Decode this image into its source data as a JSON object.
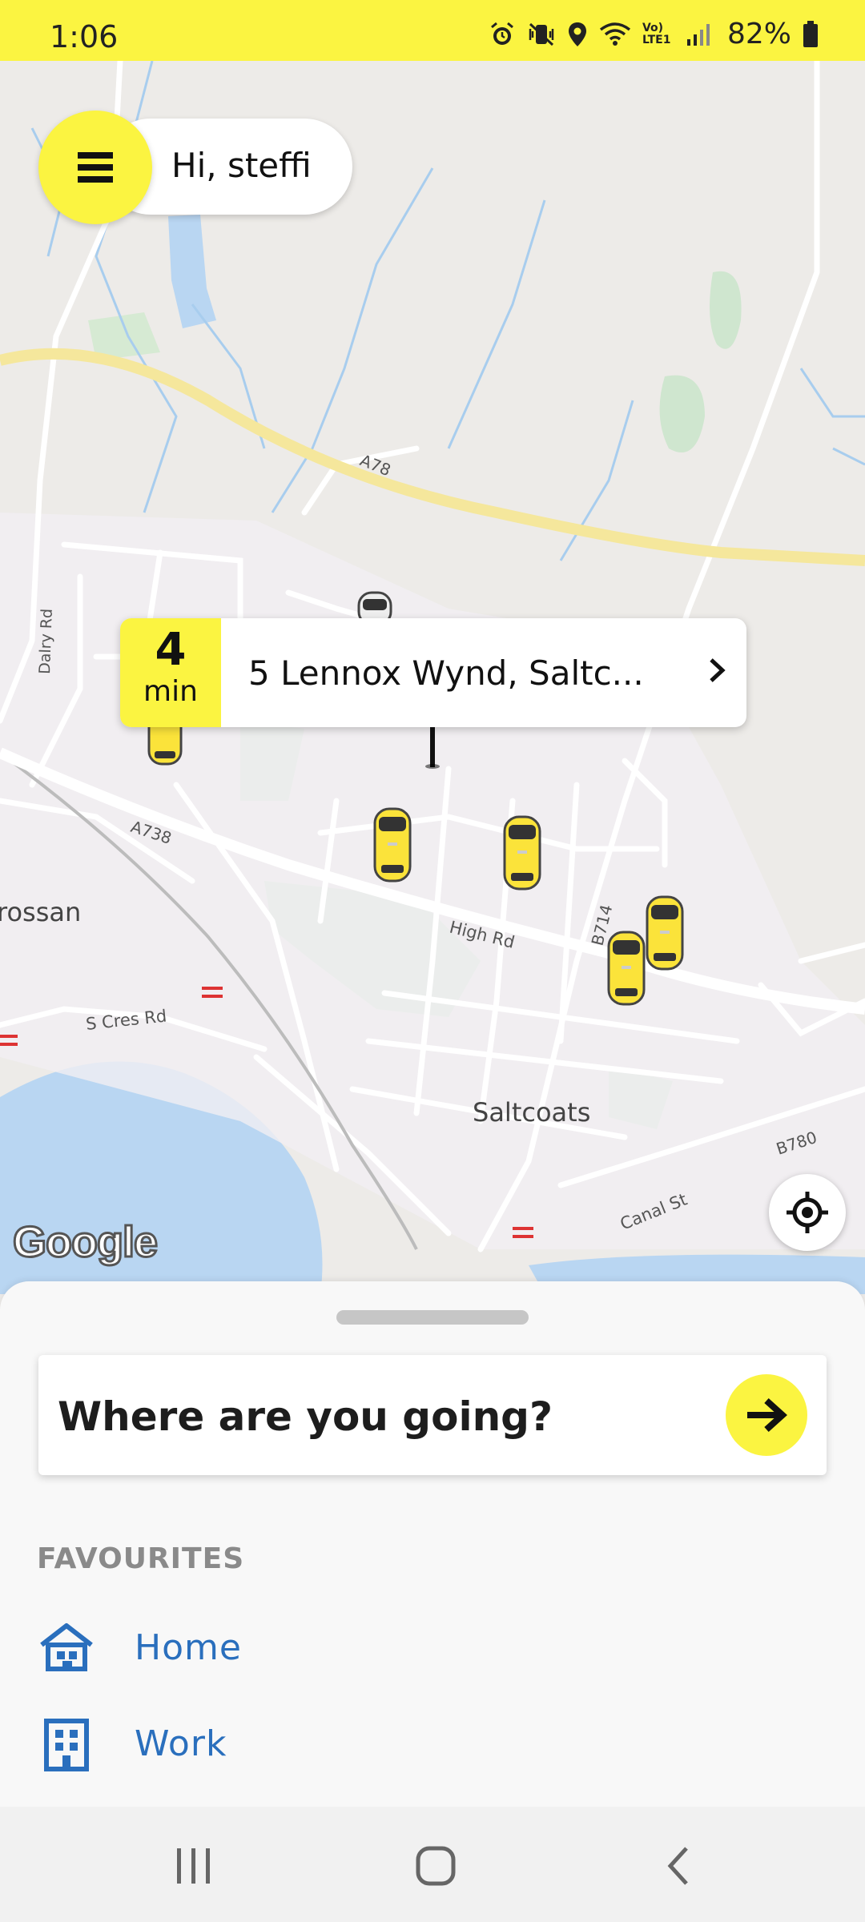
{
  "status_bar": {
    "time": "1:06",
    "battery_percent": "82%",
    "network_label": "Vo) LTE1",
    "icons": [
      "alarm-icon",
      "mute-vibrate-icon",
      "location-icon",
      "wifi-icon",
      "signal-icon",
      "battery-icon"
    ]
  },
  "header": {
    "greeting": "Hi, steffi"
  },
  "map": {
    "eta_value": "4",
    "eta_unit": "min",
    "pickup_address": "5 Lennox Wynd, Saltc...",
    "labels": {
      "a78": "A78",
      "a738": "A738",
      "high_rd": "High Rd",
      "b714": "B714",
      "b780": "B780",
      "canal_st": "Canal St",
      "s_cres_rd": "S Cres Rd",
      "dalry_rd": "Dalry Rd",
      "rossan": "rossan",
      "saltcoats": "Saltcoats"
    },
    "attribution": "Google",
    "cars_visible": 6
  },
  "sheet": {
    "search_prompt": "Where are you going?",
    "favourites_heading": "FAVOURITES",
    "favourites": [
      {
        "label": "Home",
        "icon": "home-icon"
      },
      {
        "label": "Work",
        "icon": "building-icon"
      }
    ]
  },
  "colors": {
    "brand_yellow": "#fbf441",
    "link_blue": "#2a6fbd",
    "water": "#b9d6f2",
    "park": "#cfe6cf"
  }
}
